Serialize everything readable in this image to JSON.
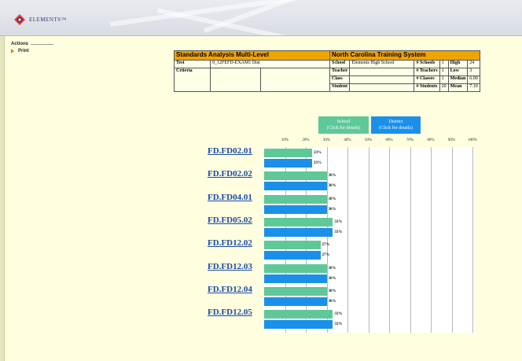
{
  "app": {
    "logo_text": "ELEMENTS™"
  },
  "sidebar": {
    "title": "Actions",
    "items": [
      {
        "label": "Print"
      }
    ]
  },
  "info_table": {
    "title_left": "Standards Analysis Multi-Level",
    "title_right": "North Carolina Training System",
    "test_label": "Test",
    "test_value": "9_12FEFD-EXAM1 Dist",
    "criteria_label": "Criteria",
    "school_label": "School",
    "school_value": "Elements High School",
    "teacher_label": "Teacher",
    "class_label": "Class",
    "student_label": "Student",
    "stats": [
      {
        "label": "# Schools",
        "count": "1",
        "stat_label": "High",
        "stat_value": "24"
      },
      {
        "label": "# Teachers",
        "count": "1",
        "stat_label": "Low",
        "stat_value": "3"
      },
      {
        "label": "# Classes",
        "count": "1",
        "stat_label": "Median",
        "stat_value": "6.00"
      },
      {
        "label": "# Students",
        "count": "20",
        "stat_label": "Mean",
        "stat_value": "7.10"
      }
    ]
  },
  "legend": {
    "school": {
      "label": "School",
      "sub": "(Click for details)"
    },
    "district": {
      "label": "District",
      "sub": "(Click for details)"
    }
  },
  "colors": {
    "school": "#5ec898",
    "district": "#1a90ea",
    "header": "#f0a400"
  },
  "chart_data": {
    "type": "bar",
    "orientation": "horizontal",
    "x_ticks": [
      "10%",
      "20%",
      "30%",
      "40%",
      "50%",
      "60%",
      "70%",
      "80%",
      "90%",
      "100%"
    ],
    "xlim": [
      0,
      100
    ],
    "categories": [
      "FD.FD02.01",
      "FD.FD02.02",
      "FD.FD04.01",
      "FD.FD05.02",
      "FD.FD12.02",
      "FD.FD12.03",
      "FD.FD12.04",
      "FD.FD12.05"
    ],
    "series": [
      {
        "name": "School",
        "values": [
          23,
          30,
          30,
          33,
          27,
          30,
          30,
          33
        ],
        "labels": [
          "23%",
          "30%",
          "30%",
          "33%",
          "27%",
          "30%",
          "30%",
          "33%"
        ]
      },
      {
        "name": "District",
        "values": [
          23,
          30,
          30,
          33,
          27,
          30,
          30,
          33
        ],
        "labels": [
          "23%",
          "30%",
          "30%",
          "33%",
          "27%",
          "30%",
          "30%",
          "33%"
        ]
      }
    ]
  }
}
